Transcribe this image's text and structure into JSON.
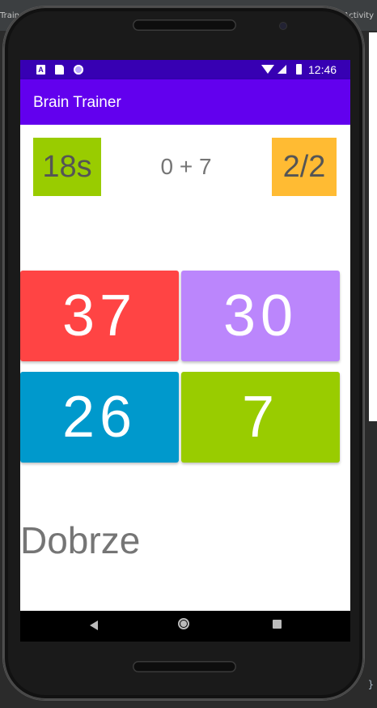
{
  "ide": {
    "left_title": "Trainer",
    "right_title": "Activity",
    "brace": "}"
  },
  "status_bar": {
    "time": "12:46",
    "left_icons": [
      "a-notification-icon",
      "sd-card-icon",
      "circle-notification-icon"
    ],
    "right_icons": [
      "wifi-icon",
      "signal-icon",
      "battery-icon"
    ]
  },
  "app_bar": {
    "title": "Brain Trainer"
  },
  "game": {
    "timer": "18s",
    "question": "0 + 7",
    "score": "2/2",
    "answers": [
      "37",
      "30",
      "26",
      "7"
    ],
    "result": "Dobrze"
  },
  "colors": {
    "status_bar": "#3700b3",
    "app_bar": "#6200ee",
    "timer": "#99cc00",
    "score": "#ffbb33",
    "answer_0": "#ff4444",
    "answer_1": "#bb86fc",
    "answer_2": "#0099cc",
    "answer_3": "#99cc00"
  },
  "nav_bar": {
    "icons": [
      "back-icon",
      "home-icon",
      "recents-icon"
    ]
  }
}
